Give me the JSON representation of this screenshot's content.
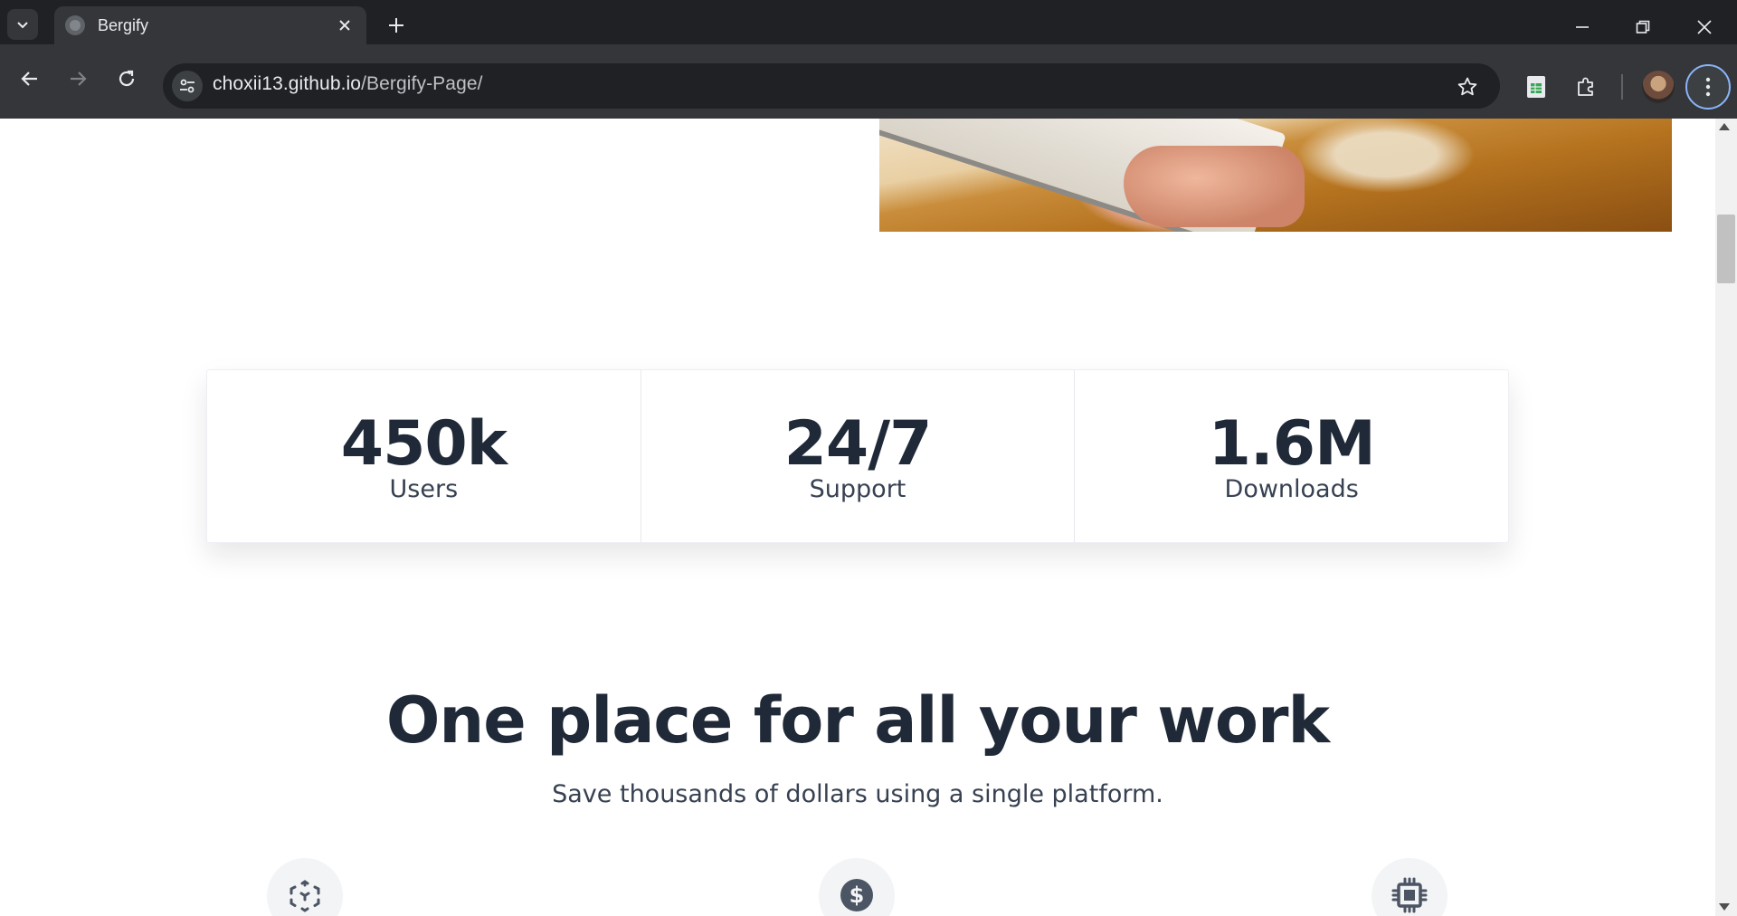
{
  "browser": {
    "tab_title": "Bergify",
    "url_host": "choxii13.github.io",
    "url_path": "/Bergify-Page/"
  },
  "stats": [
    {
      "value": "450k",
      "label": "Users"
    },
    {
      "value": "24/7",
      "label": "Support"
    },
    {
      "value": "1.6M",
      "label": "Downloads"
    }
  ],
  "section": {
    "title": "One place for all your work",
    "subtitle": "Save thousands of dollars using a single platform."
  },
  "features": [
    {
      "icon": "cube-icon"
    },
    {
      "icon": "dollar-icon"
    },
    {
      "icon": "chip-icon"
    }
  ],
  "colors": {
    "heading": "#1f2937",
    "text": "#374151",
    "chrome_dark": "#202124",
    "chrome_toolbar": "#35363a"
  }
}
